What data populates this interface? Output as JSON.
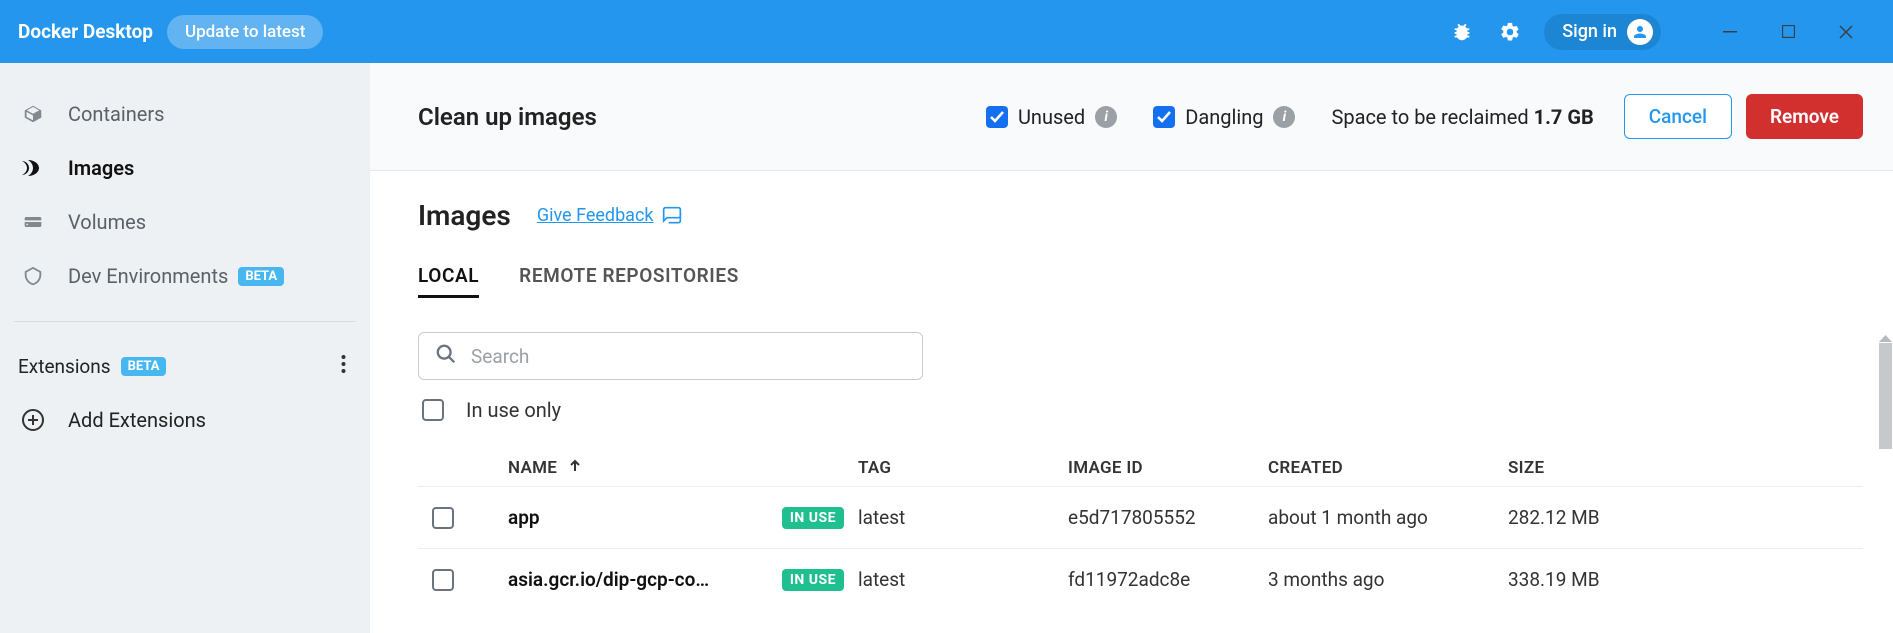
{
  "header": {
    "app_title": "Docker Desktop",
    "update_label": "Update to latest",
    "signin_label": "Sign in"
  },
  "sidebar": {
    "items": [
      {
        "label": "Containers"
      },
      {
        "label": "Images"
      },
      {
        "label": "Volumes"
      },
      {
        "label": "Dev Environments",
        "beta": "BETA"
      }
    ],
    "extensions_label": "Extensions",
    "extensions_beta": "BETA",
    "add_extensions_label": "Add Extensions"
  },
  "cleanup": {
    "title": "Clean up images",
    "unused_label": "Unused",
    "dangling_label": "Dangling",
    "reclaim_prefix": "Space to be reclaimed ",
    "reclaim_value": "1.7 GB",
    "cancel": "Cancel",
    "remove": "Remove"
  },
  "page": {
    "title": "Images",
    "feedback": "Give Feedback"
  },
  "tabs": {
    "local": "LOCAL",
    "remote": "REMOTE REPOSITORIES"
  },
  "search": {
    "placeholder": "Search"
  },
  "filters": {
    "in_use_only": "In use only"
  },
  "table": {
    "headers": {
      "name": "NAME",
      "tag": "TAG",
      "image_id": "IMAGE ID",
      "created": "CREATED",
      "size": "SIZE"
    },
    "inuse_badge": "IN USE",
    "rows": [
      {
        "name": "app",
        "tag": "latest",
        "image_id": "e5d717805552",
        "created": "about 1 month ago",
        "size": "282.12 MB",
        "in_use": true
      },
      {
        "name": "asia.gcr.io/dip-gcp-co…",
        "tag": "latest",
        "image_id": "fd11972adc8e",
        "created": "3 months ago",
        "size": "338.19 MB",
        "in_use": true
      }
    ]
  }
}
